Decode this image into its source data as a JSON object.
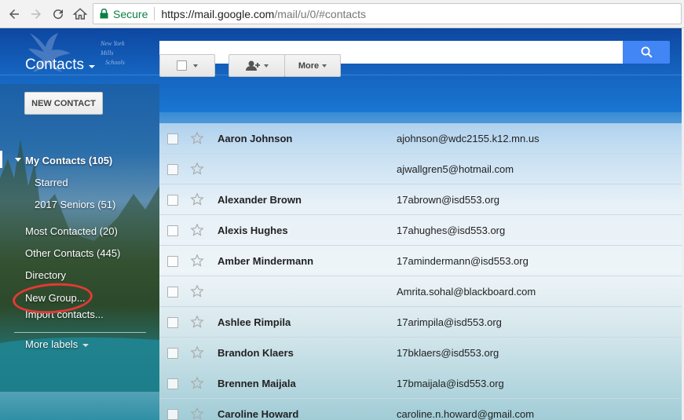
{
  "browser": {
    "secure_label": "Secure",
    "url_host": "https://mail.google.com",
    "url_path": "/mail/u/0/#contacts"
  },
  "header": {
    "logo_text_line1": "New York Mills",
    "logo_text_line2": "Schools"
  },
  "toolbar": {
    "title": "Contacts",
    "more_label": "More"
  },
  "sidebar": {
    "new_contact_label": "NEW CONTACT",
    "my_contacts": "My Contacts (105)",
    "starred": "Starred",
    "seniors": "2017 Seniors (51)",
    "most_contacted": "Most Contacted (20)",
    "other_contacts": "Other Contacts (445)",
    "directory": "Directory",
    "new_group": "New Group...",
    "import_contacts": "Import contacts...",
    "more_labels": "More labels"
  },
  "contacts": [
    {
      "name": "Aaron Johnson",
      "email": "ajohnson@wdc2155.k12.mn.us"
    },
    {
      "name": "",
      "email": "ajwallgren5@hotmail.com"
    },
    {
      "name": "Alexander Brown",
      "email": "17abrown@isd553.org"
    },
    {
      "name": "Alexis Hughes",
      "email": "17ahughes@isd553.org"
    },
    {
      "name": "Amber Mindermann",
      "email": "17amindermann@isd553.org"
    },
    {
      "name": "",
      "email": "Amrita.sohal@blackboard.com"
    },
    {
      "name": "Ashlee Rimpila",
      "email": "17arimpila@isd553.org"
    },
    {
      "name": "Brandon Klaers",
      "email": "17bklaers@isd553.org"
    },
    {
      "name": "Brennen Maijala",
      "email": "17bmaijala@isd553.org"
    },
    {
      "name": "Caroline Howard",
      "email": "caroline.n.howard@gmail.com"
    }
  ]
}
